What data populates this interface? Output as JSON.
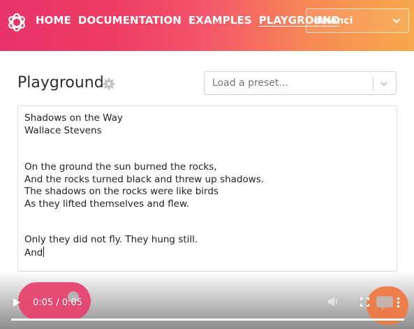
{
  "header": {
    "logo_icon": "openai-logo-icon",
    "nav": [
      {
        "label": "HOME",
        "active": false
      },
      {
        "label": "DOCUMENTATION",
        "active": false
      },
      {
        "label": "EXAMPLES",
        "active": false
      },
      {
        "label": "PLAYGROUND",
        "active": true
      }
    ],
    "engine_select": {
      "value": "davinci",
      "icon": "chevron-down-icon"
    }
  },
  "main": {
    "title": "Playground",
    "settings_icon": "gear-icon",
    "preset_select": {
      "placeholder": "Load a preset...",
      "icon": "chevron-down-icon"
    },
    "editor_lines": [
      "Shadows on the Way",
      "Wallace Stevens",
      "",
      "",
      "On the ground the sun burned the rocks,",
      "And the rocks turned black and threw up shadows.",
      "The shadows on the rocks were like birds",
      "As they lifted themselves and flew.",
      "",
      "",
      "Only they did not fly. They hung still.",
      "And"
    ]
  },
  "video": {
    "time": "0:05 / 0:05",
    "progress": 1.0,
    "icons": [
      "play-icon",
      "volume-icon",
      "fullscreen-icon",
      "captions-icon",
      "more-vertical-icon"
    ]
  },
  "colors": {
    "header_start": "#e8336b",
    "header_end": "#f7a94a",
    "text": "#222222"
  }
}
